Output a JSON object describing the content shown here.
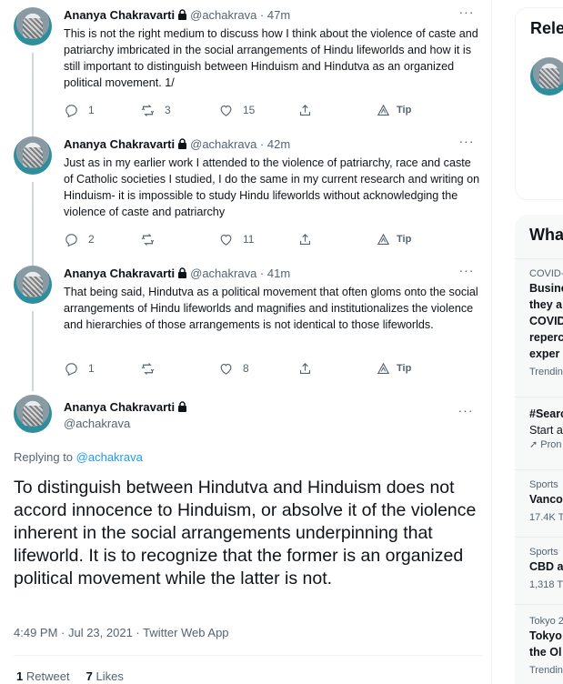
{
  "thread": [
    {
      "name": "Ananya Chakravarti",
      "handle": "@achakrava",
      "time": "47m",
      "text": "This is not the right medium to discuss how I think about the violence of caste and patriarchy imbricated in the social arrangements of Hindu lifeworlds and how it is still important to distinguish between Hinduism and Hindutva as an organized political movement. 1/",
      "replies": "1",
      "retweets": "3",
      "likes": "15",
      "tip_label": "Tip"
    },
    {
      "name": "Ananya Chakravarti",
      "handle": "@achakrava",
      "time": "42m",
      "text": "Just as in my earlier work I attended to the violence of patriarchy, race and caste of Catholic societies I studied, I do the same in my current research and writing on Hinduism- it is impossible to study Hindu lifeworlds without acknowledging the violence of caste and patriarchy",
      "replies": "2",
      "retweets": "",
      "likes": "11",
      "tip_label": "Tip"
    },
    {
      "name": "Ananya Chakravarti",
      "handle": "@achakrava",
      "time": "41m",
      "text": "That being said, Hindutva as a political movement that often gloms onto the social arrangements of Hindu lifeworlds and magnifies and institutionalizes the violence and hierarchies of those arrangements is not identical to those lifeworlds.",
      "replies": "1",
      "retweets": "",
      "likes": "8",
      "tip_label": "Tip"
    }
  ],
  "main_tweet": {
    "name": "Ananya Chakravarti",
    "handle": "@achakrava",
    "replying_prefix": "Replying to",
    "replying_handle": "@achakrava",
    "text": "To distinguish between Hindutva and Hinduism does not accord innocence to Hinduism, or absolve it of the violence inherent in the social arrangements underpinning that lifeworld. It is to recognize that the former is an organized political movement while the latter is not.",
    "timestamp": "4:49 PM · Jul 23, 2021 · Twitter Web App",
    "retweet_count": "1",
    "retweet_label": "Retweet",
    "like_count": "7",
    "like_label": "Likes"
  },
  "sidebar": {
    "relevant_title": "Rele",
    "whats_title": "Wha",
    "trends": [
      {
        "context": "COVID-",
        "lines": [
          "Busine",
          "they a",
          "COVID",
          "reperc",
          "exper"
        ],
        "footer": "Trendin"
      },
      {
        "context": "",
        "lines": [
          "#Searc"
        ],
        "extra": "Start a",
        "footer": "Pron"
      },
      {
        "context": "Sports",
        "lines": [
          "Vanco"
        ],
        "footer": "17.4K T"
      },
      {
        "context": "Sports",
        "lines": [
          "CBD a"
        ],
        "footer": "1,318 T"
      },
      {
        "context": "Tokyo 2",
        "lines": [
          "Tokyo",
          "the Ol"
        ],
        "footer": "Trendin"
      }
    ]
  },
  "colors": {
    "accent": "#1d9bf0",
    "muted_text": "#536471",
    "thread_line": "#cfd9de"
  }
}
